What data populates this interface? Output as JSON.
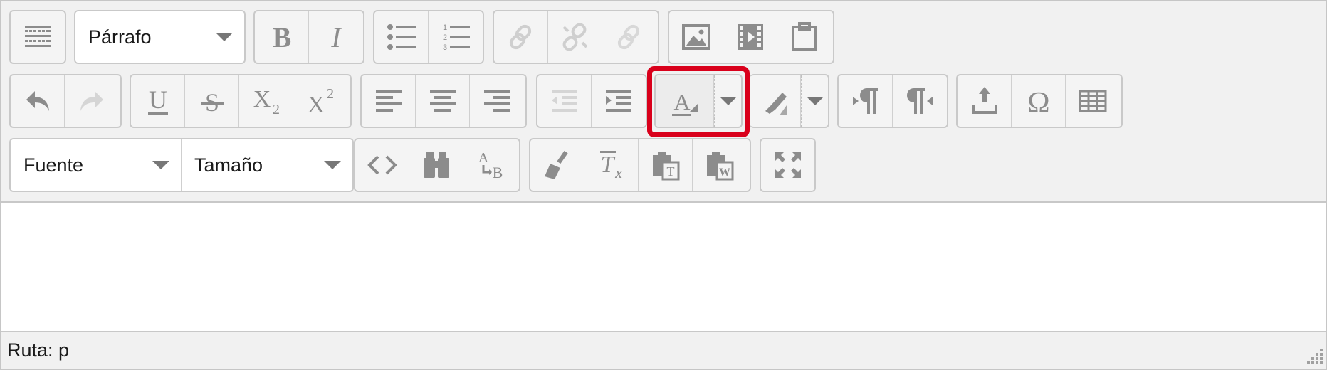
{
  "toolbar": {
    "block_format": {
      "value": "Párrafo"
    },
    "font_family": {
      "value": "Fuente"
    },
    "font_size": {
      "value": "Tamaño"
    }
  },
  "icons": {
    "row1": [
      "toolbar-toggle-icon",
      "bold-icon",
      "italic-icon",
      "bullet-list-icon",
      "numbered-list-icon",
      "link-icon",
      "unlink-icon",
      "anchor-icon",
      "image-icon",
      "media-icon",
      "paste-icon"
    ],
    "row2": [
      "undo-icon",
      "redo-icon",
      "underline-icon",
      "strikethrough-icon",
      "subscript-icon",
      "superscript-icon",
      "align-left-icon",
      "align-center-icon",
      "align-right-icon",
      "outdent-icon",
      "indent-icon",
      "text-color-icon",
      "background-color-icon",
      "ltr-icon",
      "rtl-icon",
      "upload-icon",
      "special-char-icon",
      "table-icon"
    ],
    "row3": [
      "code-icon",
      "find-icon",
      "replace-icon",
      "clean-icon",
      "remove-format-icon",
      "paste-text-icon",
      "paste-word-icon",
      "fullscreen-icon"
    ]
  },
  "colors": {
    "highlight": "#d9001b",
    "icon": "#8c8c8c",
    "disabled_icon": "#cfcfcf"
  },
  "status": {
    "path": "Ruta: p"
  }
}
